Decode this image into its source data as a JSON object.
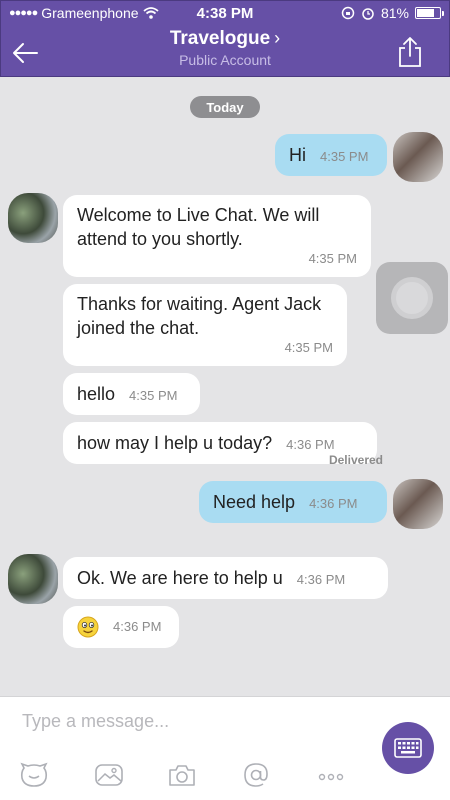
{
  "status_bar": {
    "carrier": "Grameenphone",
    "time": "4:38 PM",
    "battery": "81%",
    "battery_fraction": 0.81
  },
  "header": {
    "title": "Travelogue",
    "chevron": "›",
    "subtitle": "Public Account",
    "back_icon": "back-arrow-icon",
    "share_icon": "share-icon"
  },
  "chat": {
    "date_separator": "Today",
    "messages": [
      {
        "direction": "out",
        "text": "Hi",
        "time": "4:35 PM"
      },
      {
        "direction": "in",
        "text": "Welcome to Live Chat. We will attend to you shortly.",
        "time": "4:35 PM"
      },
      {
        "direction": "in",
        "text": "Thanks for waiting. Agent Jack joined the chat.",
        "time": "4:35 PM"
      },
      {
        "direction": "in",
        "text": "hello",
        "time": "4:35 PM"
      },
      {
        "direction": "in",
        "text": "how may I help u today?",
        "time": "4:36 PM"
      },
      {
        "direction": "out",
        "text": "Need help",
        "time": "4:36 PM"
      },
      {
        "direction": "in",
        "text": "Ok. We are here to help u",
        "time": "4:36 PM"
      },
      {
        "direction": "in",
        "emoji": "smiley-emoji",
        "time": "4:36 PM"
      }
    ],
    "delivered_label": "Delivered"
  },
  "composer": {
    "placeholder": "Type a message...",
    "tools": [
      "sticker-icon",
      "image-icon",
      "camera-icon",
      "mention-icon",
      "more-icon"
    ],
    "keyboard_icon": "keyboard-icon"
  },
  "colors": {
    "header": "#6650a6",
    "outgoing_bubble": "#a9dcf2",
    "incoming_bubble": "#ffffff",
    "background": "#e4e4e6"
  }
}
